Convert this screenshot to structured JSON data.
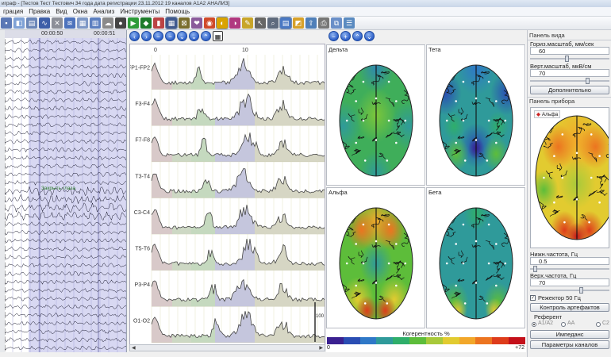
{
  "window": {
    "title": "играф - [Тестов Тест Тестович 34 года дата регистрации 23.11.2012 19 каналов A1A2 АНАЛИЗ]"
  },
  "menu": [
    "грация",
    "Правка",
    "Вид",
    "Окна",
    "Анализ",
    "Инструменты",
    "Помощь"
  ],
  "toolbar": {
    "icons": [
      "save-icon",
      "open-icon",
      "print-preview-icon",
      "signal-icon",
      "tools-icon",
      "eeg-view-icon",
      "grid-icon",
      "chart-view-icon",
      "montage-icon",
      "settings-icon",
      "play-icon",
      "record-icon",
      "bar-chart-icon",
      "spectrum-icon",
      "topo-icon",
      "heart-icon",
      "brain-icon",
      "color-wheel-icon",
      "photo-icon",
      "pencil-icon",
      "cursor-icon",
      "zoom-icon",
      "table-icon",
      "layout-icon",
      "export-icon",
      "printer-icon",
      "copy-icon",
      "notes-icon"
    ]
  },
  "eeg": {
    "time_start": "00:00:50",
    "time_end": "00:00:51",
    "event_label": "Закрыть глаза"
  },
  "spectra": {
    "axis_ticks": [
      "0",
      "10"
    ],
    "channels": [
      "FP1-FP2",
      "F3-F4",
      "F7-F8",
      "T3-T4",
      "C3-C4",
      "T5-T6",
      "P3-P4",
      "O1-O2"
    ],
    "peak_label": "100"
  },
  "topomaps": [
    {
      "title": "Дельта"
    },
    {
      "title": "Тета"
    },
    {
      "title": "Альфа"
    },
    {
      "title": "Бета"
    }
  ],
  "colorbar": {
    "title": "Когерентность %",
    "min": "0",
    "max": "+72",
    "colors": [
      "#3a2090",
      "#2a4db3",
      "#2f78c7",
      "#2f9a9a",
      "#2fae6a",
      "#5dbd3a",
      "#a8c93a",
      "#e2cb30",
      "#f2a72a",
      "#ec7420",
      "#de3c1b",
      "#c4101a"
    ]
  },
  "view_panel": {
    "title": "Панель вида",
    "horiz_label": "Гориз.масштаб, мм/сек",
    "horiz_value": "60",
    "vert_label": "Верт.масштаб, мкВ/см",
    "vert_value": "70",
    "more_button": "Дополнительно"
  },
  "device_panel": {
    "title": "Панель прибора",
    "tab_label": "Альфа",
    "low_freq_label": "Нижн.частота, Гц",
    "low_freq_value": "0.5",
    "high_freq_label": "Верх.частота, Гц",
    "high_freq_value": "70",
    "notch_label": "Режектор 50 Гц",
    "artifact_button": "Контроль артефактов",
    "reference_label": "Референт",
    "ref_options": [
      "A1/A2",
      "AA",
      "C2"
    ],
    "impedance_button": "Импеданс",
    "channels_button": "Параметры каналов"
  }
}
